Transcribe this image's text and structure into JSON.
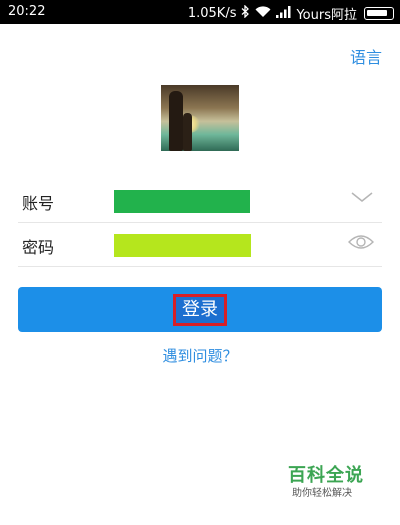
{
  "status_bar": {
    "time": "20:22",
    "speed": "1.05K/s",
    "carrier": "Yours阿拉",
    "icons": [
      "bluetooth-icon",
      "wifi-icon",
      "signal-icon",
      "battery-icon"
    ]
  },
  "header": {
    "language_link": "语言"
  },
  "form": {
    "account_label": "账号",
    "account_icon": "chevron-down-icon",
    "account_fill_color": "#22b24c",
    "password_label": "密码",
    "password_icon": "eye-icon",
    "password_fill_color": "#b5e61d"
  },
  "login_button": {
    "label": "登录",
    "color": "#1c8fe8",
    "highlight_color": "#d81f26"
  },
  "help_link": "遇到问题？",
  "watermark": {
    "title": "百科全说",
    "subtitle": "助你轻松解决"
  }
}
